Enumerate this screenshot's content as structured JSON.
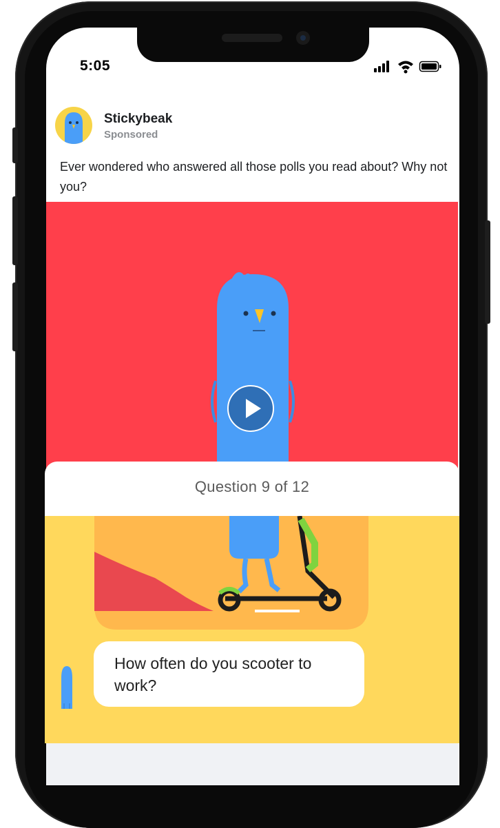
{
  "status_bar": {
    "time": "5:05"
  },
  "post": {
    "brand_name": "Stickybeak",
    "sponsored_label": "Sponsored",
    "caption": "Ever wondered who answered all those polls you read about? Why not you?"
  },
  "quiz": {
    "progress": "Question 9 of 12",
    "question": "How often do you scooter to work?"
  },
  "colors": {
    "video_bg": "#ff3f4b",
    "quiz_bg": "#ffd85c",
    "bird_blue": "#4a9ef8",
    "avatar_bg": "#f7d448"
  }
}
